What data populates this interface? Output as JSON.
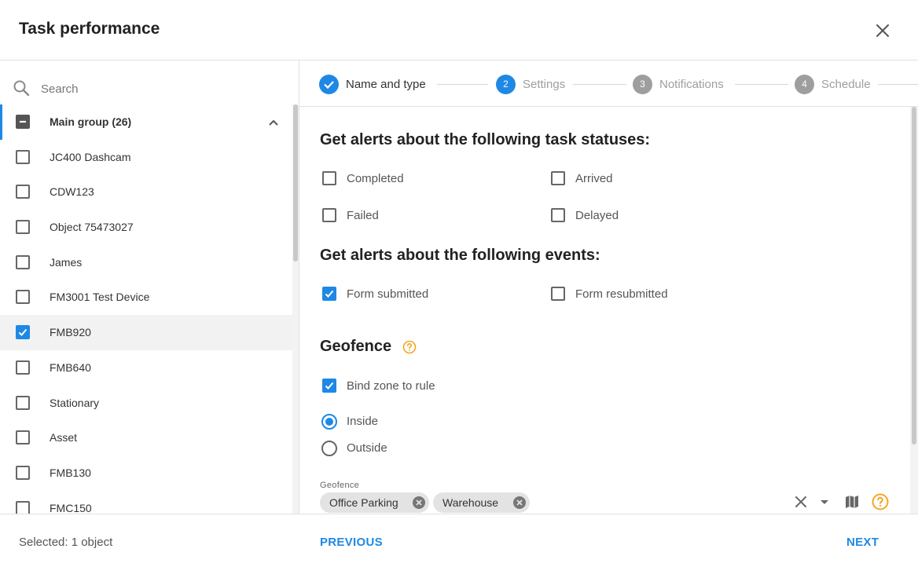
{
  "dialog": {
    "title": "Task performance",
    "close_icon": "close-icon"
  },
  "search": {
    "placeholder": "Search",
    "icon": "search-icon"
  },
  "object_list": {
    "group_label": "Main group (26)",
    "group_state": "indeterminate",
    "items": [
      {
        "label": "JC400 Dashcam",
        "checked": false
      },
      {
        "label": "CDW123",
        "checked": false
      },
      {
        "label": "Object 75473027",
        "checked": false
      },
      {
        "label": "James",
        "checked": false
      },
      {
        "label": "FM3001 Test Device",
        "checked": false
      },
      {
        "label": "FMB920",
        "checked": true
      },
      {
        "label": "FMB640",
        "checked": false
      },
      {
        "label": "Stationary",
        "checked": false
      },
      {
        "label": "Asset",
        "checked": false
      },
      {
        "label": "FMB130",
        "checked": false
      },
      {
        "label": "FMC150",
        "checked": false
      }
    ]
  },
  "stepper": {
    "steps": [
      {
        "number": "",
        "label": "Name and type",
        "state": "completed"
      },
      {
        "number": "2",
        "label": "Settings",
        "state": "active"
      },
      {
        "number": "3",
        "label": "Notifications",
        "state": "inactive"
      },
      {
        "number": "4",
        "label": "Schedule",
        "state": "inactive"
      }
    ]
  },
  "task_statuses": {
    "title": "Get alerts about the following task statuses:",
    "options": [
      {
        "label": "Completed",
        "checked": false
      },
      {
        "label": "Arrived",
        "checked": false
      },
      {
        "label": "Failed",
        "checked": false
      },
      {
        "label": "Delayed",
        "checked": false
      }
    ]
  },
  "events": {
    "title": "Get alerts about the following events:",
    "options": [
      {
        "label": "Form submitted",
        "checked": true
      },
      {
        "label": "Form resubmitted",
        "checked": false
      }
    ]
  },
  "geofence": {
    "title": "Geofence",
    "bind_zone_label": "Bind zone to rule",
    "bind_zone_checked": true,
    "inside_label": "Inside",
    "outside_label": "Outside",
    "selected_mode": "inside",
    "field_label": "Geofence",
    "chips": [
      "Office Parking",
      "Warehouse"
    ]
  },
  "footer": {
    "selected_text": "Selected: 1 object",
    "previous_label": "PREVIOUS",
    "next_label": "NEXT"
  },
  "colors": {
    "accent": "#1e88e5",
    "help": "#f5a623",
    "muted": "#9e9e9e"
  }
}
